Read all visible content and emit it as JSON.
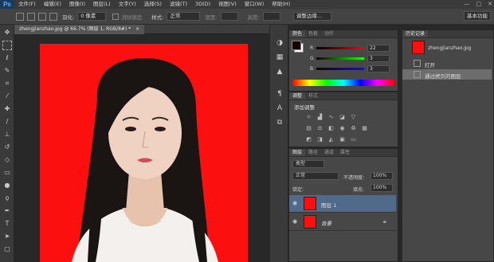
{
  "menubar": {
    "logo": "Ps",
    "items": [
      "文件(F)",
      "编辑(E)",
      "图像(I)",
      "图层(L)",
      "文字(Y)",
      "选择(S)",
      "滤镜(T)",
      "3D(D)",
      "视图(V)",
      "窗口(W)",
      "帮助(H)"
    ],
    "window_buttons": [
      "—",
      "□",
      "✕"
    ]
  },
  "optionsbar": {
    "feather_label": "羽化:",
    "feather_value": "0 像素",
    "antialias_label": "消除锯齿",
    "style_label": "样式:",
    "style_value": "正常",
    "width_label": "宽度:",
    "height_label": "高度:",
    "refine_label": "调整边缘...",
    "workspace": "基本功能"
  },
  "document": {
    "tab_title": "zhengjianzhao.jpg @ 66.7% (图层 1, RGB/8#) *",
    "tab_close": "×"
  },
  "color_panel": {
    "tabs": [
      "颜色",
      "色板",
      "动作"
    ],
    "r_label": "R",
    "g_label": "G",
    "b_label": "B",
    "r_value": "22",
    "g_value": "3",
    "b_value": "3",
    "foreground": "#16030 3",
    "fg_hex": "#160303",
    "bg_hex": "#ffffff"
  },
  "adjust_panel": {
    "tabs": [
      "调整",
      "样式"
    ],
    "title": "添加调整"
  },
  "layers_panel": {
    "tabs": [
      "图层",
      "路径",
      "通道",
      "属性"
    ],
    "kind_label": "类型",
    "blend_mode": "正常",
    "opacity_label": "不透明度:",
    "opacity_value": "100%",
    "lock_label": "锁定:",
    "fill_label": "填充:",
    "fill_value": "100%",
    "layers": [
      {
        "name": "图层 1",
        "selected": true
      },
      {
        "name": "背景",
        "selected": false
      }
    ]
  },
  "history_panel": {
    "tabs": [
      "历史记录"
    ],
    "snapshot_name": "zhengjianzhao.jpg",
    "items": [
      "打开",
      "通过拷贝的图层"
    ]
  }
}
